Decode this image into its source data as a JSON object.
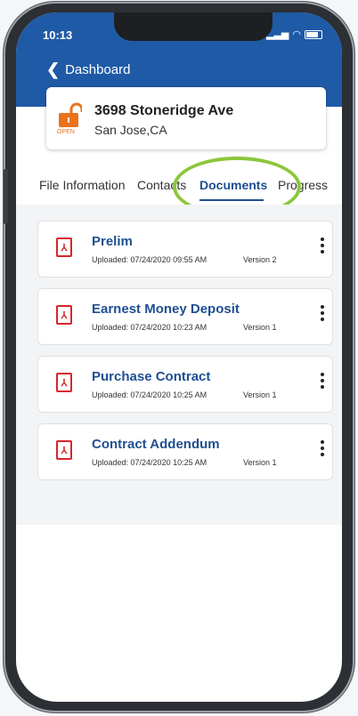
{
  "status_bar": {
    "time": "10:13"
  },
  "header": {
    "back_label": "Dashboard"
  },
  "address": {
    "title": "3698 Stoneridge Ave",
    "city": "San Jose,CA",
    "lock_label": "OPEN"
  },
  "tabs": [
    {
      "label": "File Information"
    },
    {
      "label": "Contacts"
    },
    {
      "label": "Documents"
    },
    {
      "label": "Progress"
    }
  ],
  "documents": [
    {
      "title": "Prelim",
      "uploaded": "Uploaded: 07/24/2020 09:55 AM",
      "version": "Version 2"
    },
    {
      "title": "Earnest Money Deposit",
      "uploaded": "Uploaded: 07/24/2020 10:23 AM",
      "version": "Version 1"
    },
    {
      "title": "Purchase Contract",
      "uploaded": "Uploaded: 07/24/2020 10:25 AM",
      "version": "Version 1"
    },
    {
      "title": "Contract Addendum",
      "uploaded": "Uploaded: 07/24/2020 10:25 AM",
      "version": "Version 1"
    }
  ],
  "colors": {
    "brand": "#1f5aa6",
    "accent": "#1f4f91",
    "lock": "#e8731c",
    "pdf": "#d7262c",
    "highlight": "#8cc63e"
  }
}
